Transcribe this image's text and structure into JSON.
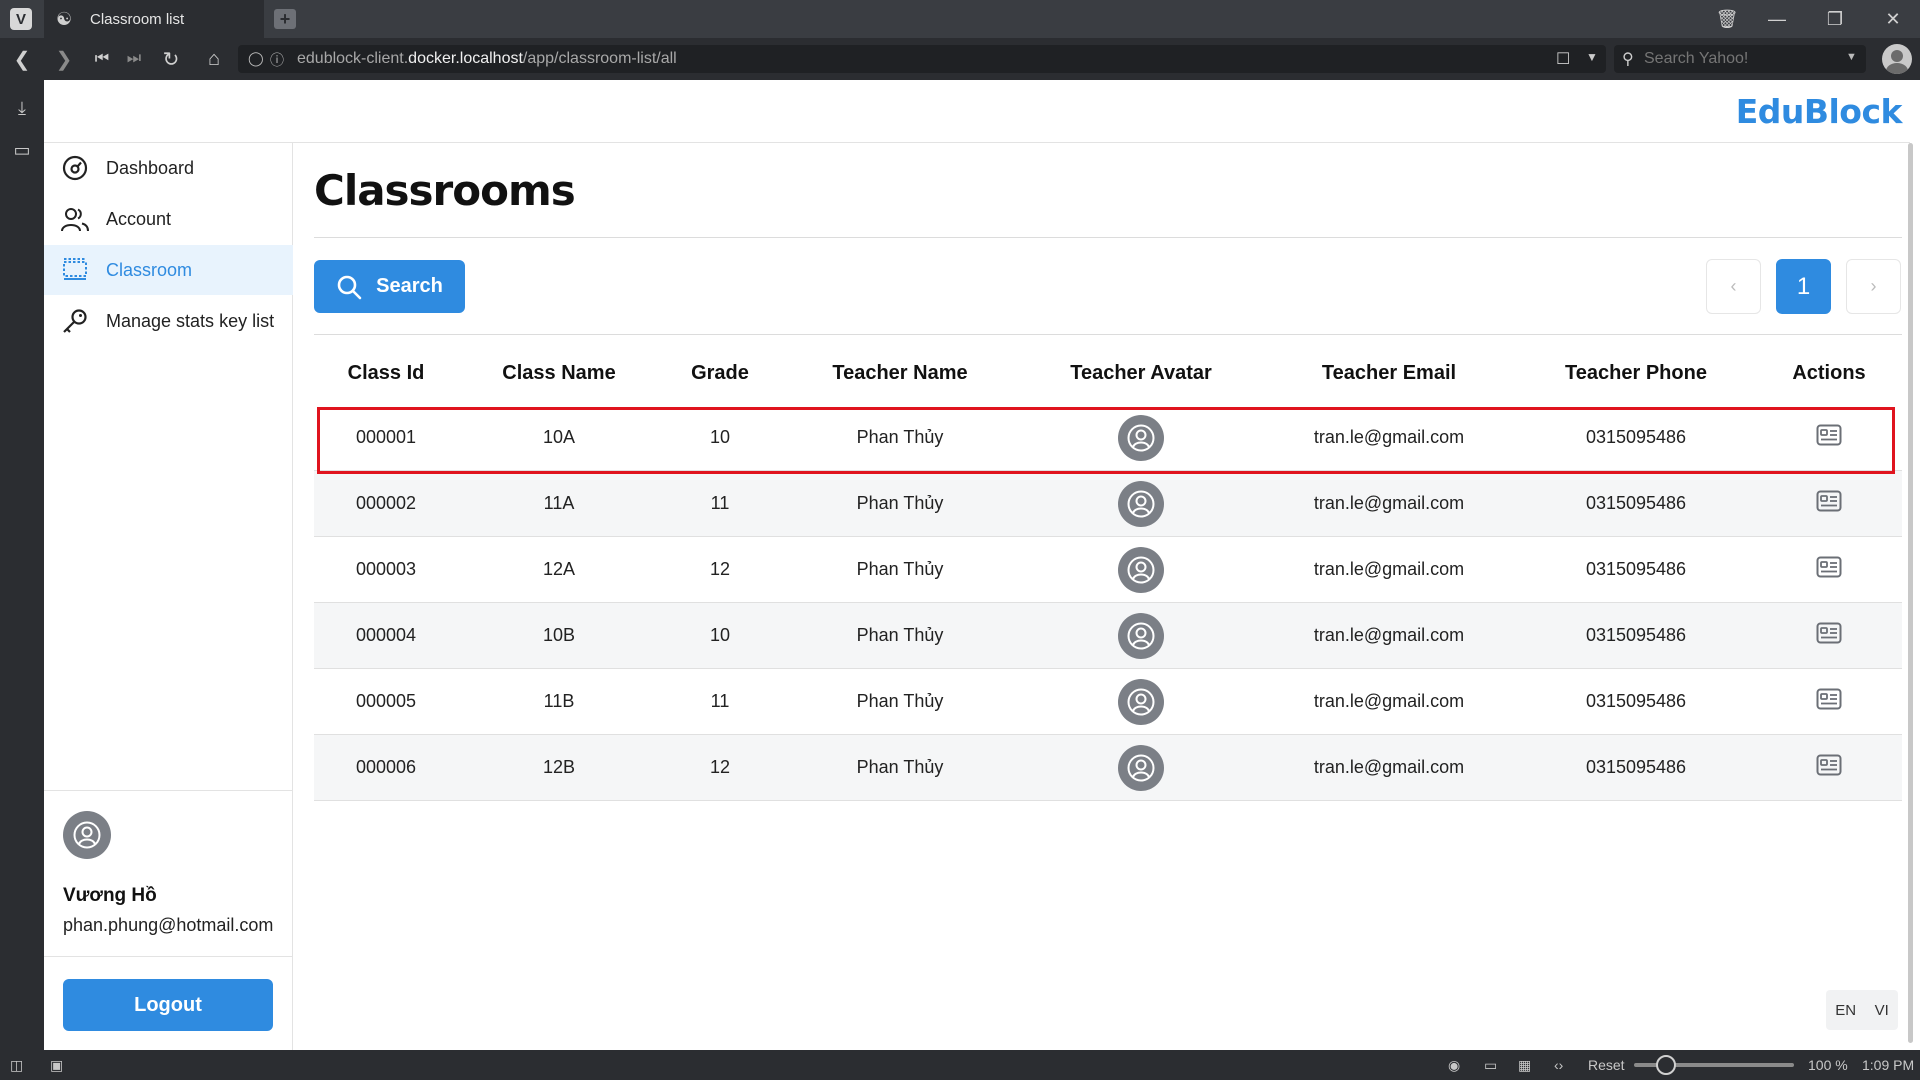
{
  "browser": {
    "tab_title": "Classroom list",
    "url_prefix": "edublock-client.",
    "url_host": "docker.localhost",
    "url_path": "/app/classroom-list/all",
    "search_placeholder": "Search Yahoo!",
    "zoom_reset": "Reset",
    "zoom_level": "100 %",
    "clock": "1:09 PM"
  },
  "brand": "EduBlock",
  "sidebar": {
    "items": [
      {
        "label": "Dashboard",
        "icon": "dashboard-icon"
      },
      {
        "label": "Account",
        "icon": "users-icon"
      },
      {
        "label": "Classroom",
        "icon": "classroom-icon"
      },
      {
        "label": "Manage stats key list",
        "icon": "key-icon"
      }
    ],
    "active_item": "Classroom",
    "user_name": "Vương Hồ",
    "user_email": "phan.phung@hotmail.com",
    "logout_label": "Logout"
  },
  "page": {
    "title": "Classrooms",
    "search_label": "Search",
    "pagination": {
      "prev": "‹",
      "current": "1",
      "next": "›"
    }
  },
  "table": {
    "headers": [
      "Class Id",
      "Class Name",
      "Grade",
      "Teacher Name",
      "Teacher Avatar",
      "Teacher Email",
      "Teacher Phone",
      "Actions"
    ],
    "rows": [
      {
        "id": "000001",
        "name": "10A",
        "grade": "10",
        "teacher": "Phan Thủy",
        "email": "tran.le@gmail.com",
        "phone": "0315095486"
      },
      {
        "id": "000002",
        "name": "11A",
        "grade": "11",
        "teacher": "Phan Thủy",
        "email": "tran.le@gmail.com",
        "phone": "0315095486"
      },
      {
        "id": "000003",
        "name": "12A",
        "grade": "12",
        "teacher": "Phan Thủy",
        "email": "tran.le@gmail.com",
        "phone": "0315095486"
      },
      {
        "id": "000004",
        "name": "10B",
        "grade": "10",
        "teacher": "Phan Thủy",
        "email": "tran.le@gmail.com",
        "phone": "0315095486"
      },
      {
        "id": "000005",
        "name": "11B",
        "grade": "11",
        "teacher": "Phan Thủy",
        "email": "tran.le@gmail.com",
        "phone": "0315095486"
      },
      {
        "id": "000006",
        "name": "12B",
        "grade": "12",
        "teacher": "Phan Thủy",
        "email": "tran.le@gmail.com",
        "phone": "0315095486"
      }
    ],
    "highlighted_row": "000001"
  },
  "language": {
    "en": "EN",
    "vi": "VI"
  },
  "colors": {
    "accent": "#2f8be0",
    "highlight": "#e0141e",
    "avatar": "#7b7f86"
  }
}
